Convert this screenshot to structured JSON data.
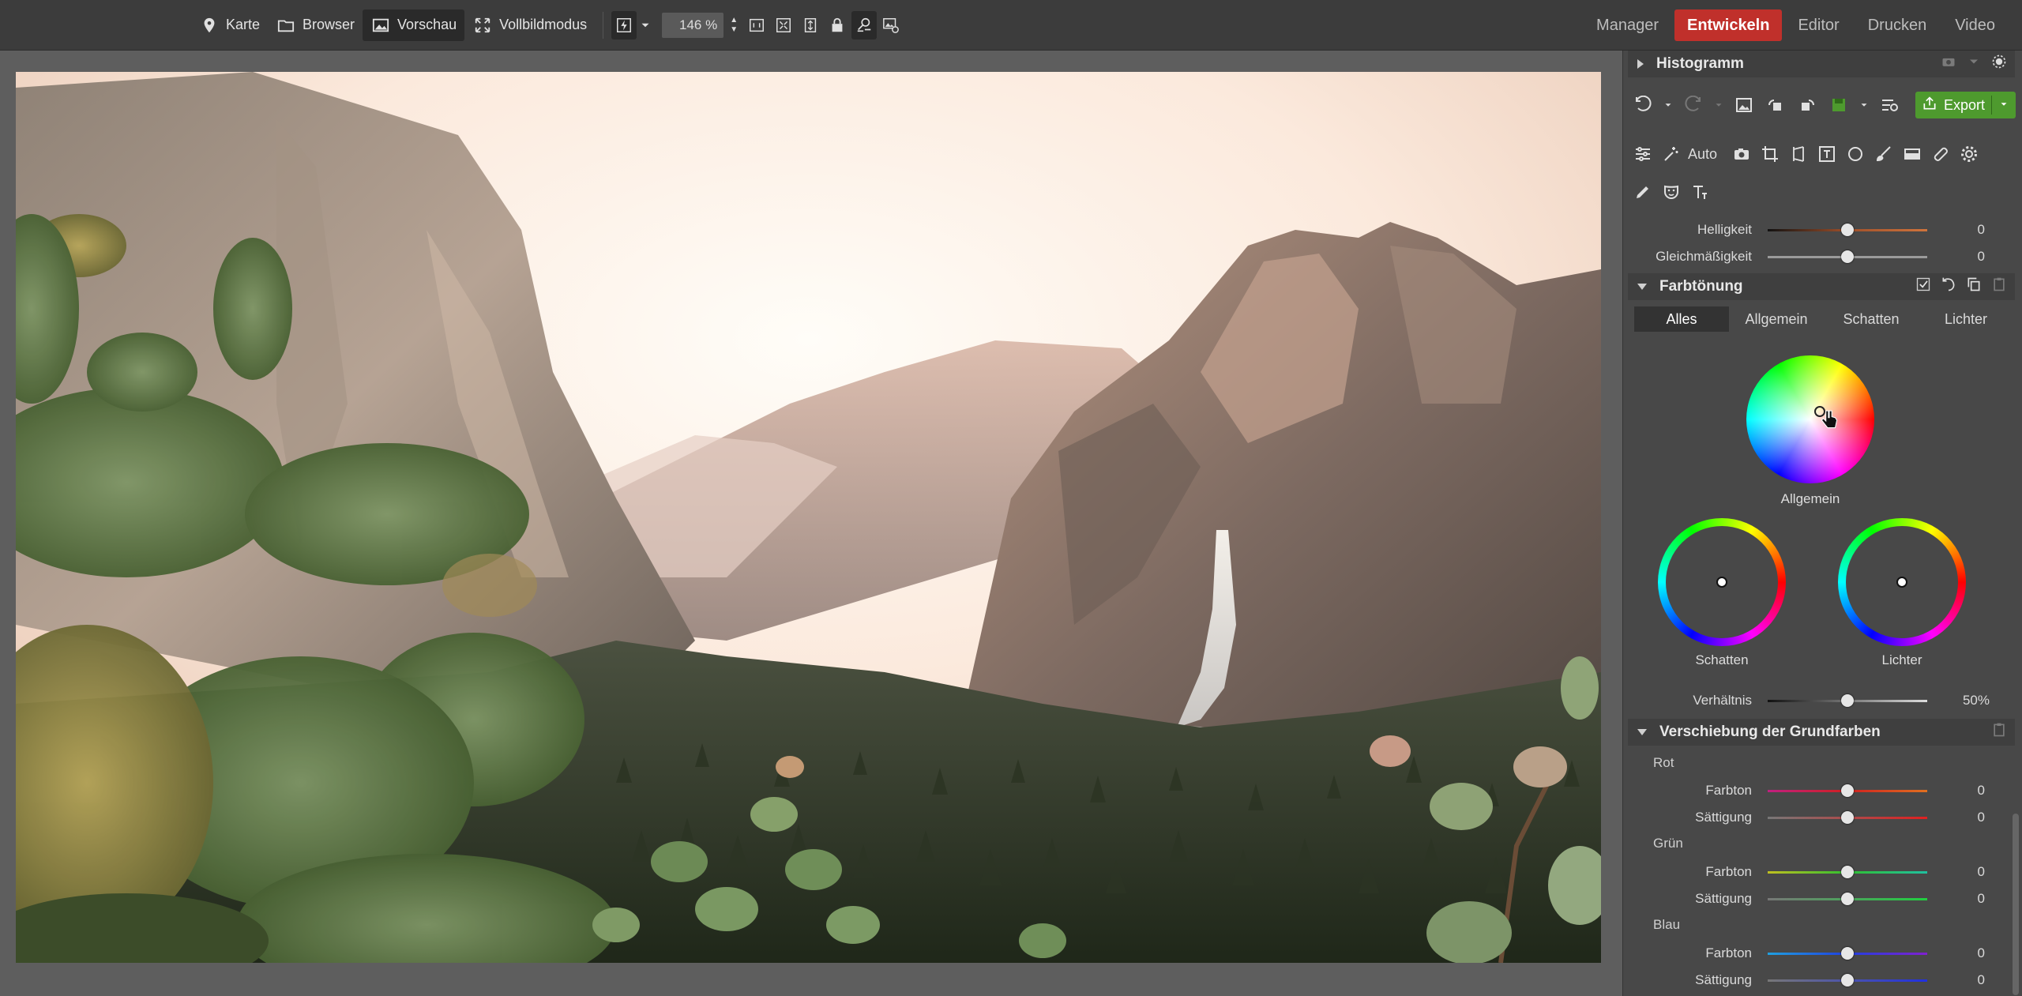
{
  "topbar": {
    "location_label": "Karte",
    "browser_label": "Browser",
    "preview_label": "Vorschau",
    "fullscreen_label": "Vollbildmodus",
    "zoom_value": "146 %",
    "onetoone_label": "1:1"
  },
  "modes": {
    "manager": "Manager",
    "develop": "Entwickeln",
    "editor": "Editor",
    "print": "Drucken",
    "video": "Video"
  },
  "panel": {
    "histogram_title": "Histogramm",
    "export_label": "Export",
    "auto_label": "Auto",
    "sliders_top": [
      {
        "label": "Helligkeit",
        "value": "0",
        "position": 0.5
      },
      {
        "label": "Gleichmäßigkeit",
        "value": "0",
        "position": 0.5
      }
    ],
    "toning": {
      "title": "Farbtönung",
      "tabs": [
        "Alles",
        "Allgemein",
        "Schatten",
        "Lichter"
      ],
      "active_tab": "Alles",
      "wheel_main_label": "Allgemein",
      "wheel_shadows_label": "Schatten",
      "wheel_highlights_label": "Lichter",
      "ratio_label": "Verhältnis",
      "ratio_value": "50%",
      "ratio_position": 0.5
    },
    "primaries": {
      "title": "Verschiebung der Grundfarben",
      "groups": [
        {
          "name": "Rot",
          "hue_label": "Farbton",
          "hue_value": "0",
          "sat_label": "Sättigung",
          "sat_value": "0"
        },
        {
          "name": "Grün",
          "hue_label": "Farbton",
          "hue_value": "0",
          "sat_label": "Sättigung",
          "sat_value": "0"
        },
        {
          "name": "Blau",
          "hue_label": "Farbton",
          "hue_value": "0",
          "sat_label": "Sättigung",
          "sat_value": "0"
        }
      ]
    }
  },
  "colors": {
    "accent_develop": "#c0302b",
    "export_green": "#4e9a2e"
  }
}
